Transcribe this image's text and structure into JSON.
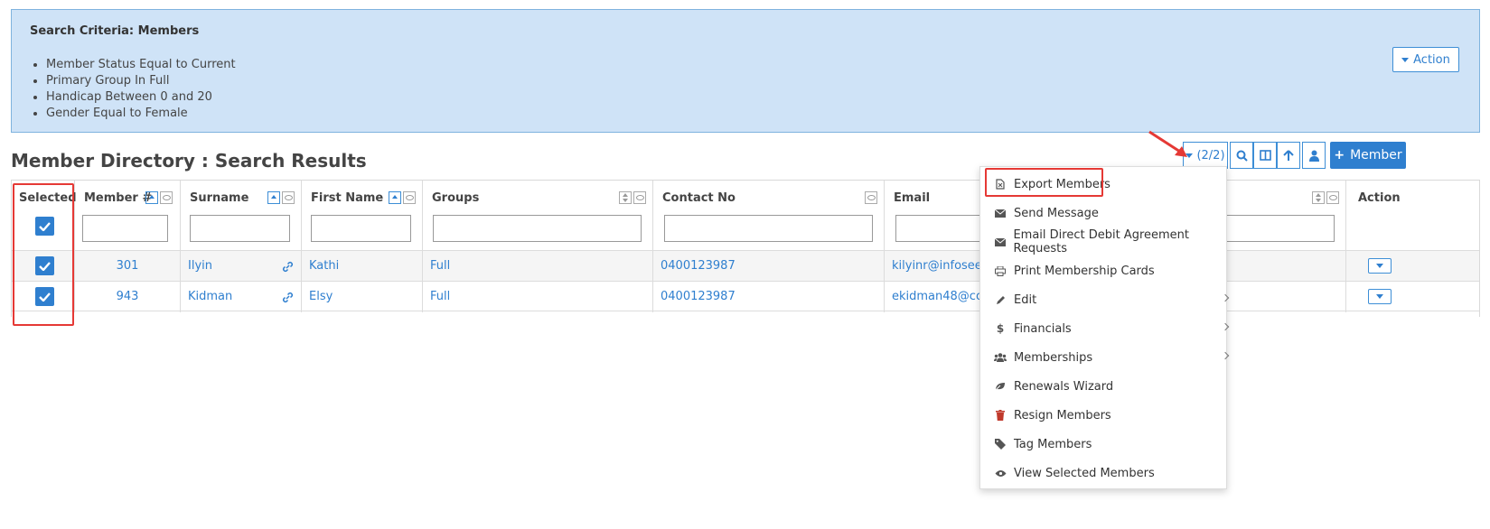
{
  "criteria": {
    "title": "Search Criteria: Members",
    "items": [
      "Member Status Equal to Current",
      "Primary Group In Full",
      "Handicap Between 0 and 20",
      "Gender Equal to Female"
    ],
    "action_label": "Action"
  },
  "page_title": "Member Directory : Search Results",
  "toolbar": {
    "selection_count": "(2/2)",
    "add_label": "Member"
  },
  "table": {
    "columns": {
      "selected": "Selected",
      "member_no": "Member #",
      "surname": "Surname",
      "first_name": "First Name",
      "groups": "Groups",
      "contact_no": "Contact No",
      "email": "Email",
      "action": "Action"
    },
    "rows": [
      {
        "member_no": "301",
        "surname": "Ilyin",
        "first_name": "Kathi",
        "groups": "Full",
        "contact_no": "0400123987",
        "email": "kilyinr@infoseek.c"
      },
      {
        "member_no": "943",
        "surname": "Kidman",
        "first_name": "Elsy",
        "groups": "Full",
        "contact_no": "0400123987",
        "email": "ekidman48@corn"
      }
    ]
  },
  "menu": {
    "items": [
      {
        "label": "Export Members",
        "icon": "file-excel-icon"
      },
      {
        "label": "Send Message",
        "icon": "envelope-icon"
      },
      {
        "label": "Email Direct Debit Agreement Requests",
        "icon": "envelope-icon"
      },
      {
        "label": "Print Membership Cards",
        "icon": "print-icon"
      },
      {
        "label": "Edit",
        "icon": "pencil-icon"
      },
      {
        "label": "Financials",
        "icon": "dollar-icon"
      },
      {
        "label": "Memberships",
        "icon": "users-icon"
      },
      {
        "label": "Renewals Wizard",
        "icon": "leaf-icon"
      },
      {
        "label": "Resign Members",
        "icon": "trash-icon"
      },
      {
        "label": "Tag Members",
        "icon": "tag-icon"
      },
      {
        "label": "View Selected Members",
        "icon": "eye-icon"
      }
    ]
  },
  "colors": {
    "accent": "#2f7fcf",
    "criteria_bg": "#cfe3f7",
    "highlight": "#e53935",
    "trash": "#c0392b"
  }
}
